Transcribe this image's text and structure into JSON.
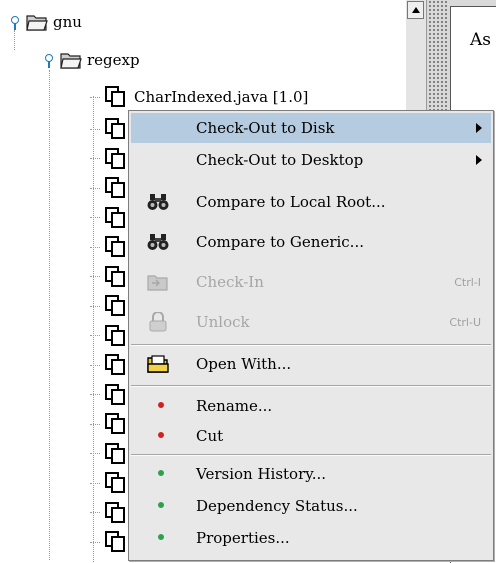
{
  "tree": {
    "root": {
      "label": "gnu"
    },
    "child": {
      "label": "regexp"
    },
    "first_file": {
      "label": "CharIndexed.java [1.0]"
    }
  },
  "context_menu": {
    "items": [
      {
        "label": "Check-Out to Disk",
        "submenu": true,
        "selected": true
      },
      {
        "label": "Check-Out to Desktop",
        "submenu": true
      },
      {
        "label": "Compare to Local Root...",
        "icon": "binoculars-icon"
      },
      {
        "label": "Compare to Generic...",
        "icon": "binoculars-icon"
      },
      {
        "label": "Check-In",
        "accel": "Ctrl-I",
        "disabled": true,
        "icon": "check-in-icon"
      },
      {
        "label": "Unlock",
        "accel": "Ctrl-U",
        "disabled": true,
        "icon": "padlock-icon"
      },
      {
        "label": "Open With...",
        "icon": "open-folder-icon"
      },
      {
        "label": "Rename...",
        "icon": "red-dot-icon"
      },
      {
        "label": "Cut",
        "icon": "red-dot-icon"
      },
      {
        "label": "Version History...",
        "icon": "green-dot-icon"
      },
      {
        "label": "Dependency Status...",
        "icon": "green-dot-icon"
      },
      {
        "label": "Properties...",
        "icon": "green-dot-icon"
      }
    ]
  },
  "right_pane": {
    "partial_text": "As"
  },
  "colors": {
    "selection": "#b5cbe0",
    "menu_bg": "#e8e8e8",
    "red_dot": "#d42020",
    "green_dot": "#2fa04a",
    "disabled_text": "#a6a6a6"
  }
}
